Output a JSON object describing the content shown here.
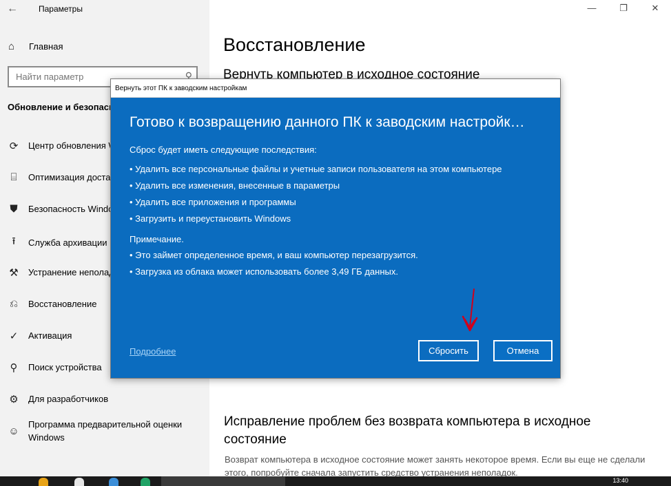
{
  "window": {
    "back_icon": "back-arrow-icon",
    "title": "Параметры",
    "controls": {
      "minimize": "—",
      "maximize": "❐",
      "close": "✕"
    }
  },
  "sidebar": {
    "home_label": "Главная",
    "search_placeholder": "Найти параметр",
    "section_title": "Обновление и безопасность",
    "items": [
      {
        "icon": "sync-icon",
        "glyph": "⟳",
        "label": "Центр обновления Windows"
      },
      {
        "icon": "delivery-optimization-icon",
        "glyph": "⌸",
        "label": "Оптимизация доставки"
      },
      {
        "icon": "shield-icon",
        "glyph": "⛊",
        "label": "Безопасность Windows"
      },
      {
        "icon": "backup-icon",
        "glyph": "⭱",
        "label": "Служба архивации"
      },
      {
        "icon": "wrench-icon",
        "glyph": "⚒",
        "label": "Устранение неполадок"
      },
      {
        "icon": "recovery-icon",
        "glyph": "⎌",
        "label": "Восстановление"
      },
      {
        "icon": "activation-icon",
        "glyph": "✓",
        "label": "Активация"
      },
      {
        "icon": "find-device-icon",
        "glyph": "⚲",
        "label": "Поиск устройства"
      },
      {
        "icon": "developer-icon",
        "glyph": "⚙",
        "label": "Для разработчиков"
      },
      {
        "icon": "insider-icon",
        "glyph": "☺",
        "label": "Программа предварительной оценки Windows"
      }
    ]
  },
  "main": {
    "heading": "Восстановление",
    "subheading": "Вернуть компьютер в исходное состояние",
    "fix_heading": "Исправление проблем без возврата компьютера в исходное состояние",
    "fix_description": "Возврат компьютера в исходное состояние может занять некоторое время. Если вы еще не сделали этого, попробуйте сначала запустить средство устранения неполадок."
  },
  "dialog": {
    "title": "Вернуть этот ПК к заводским настройкам",
    "heading": "Готово к возвращению данного ПК к заводским настройк…",
    "intro": "Сброс будет иметь следующие последствия:",
    "consequences": [
      "• Удалить все персональные файлы и учетные записи пользователя на этом компьютере",
      "• Удалить все изменения, внесенные в параметры",
      "• Удалить все приложения и программы",
      "• Загрузить и переустановить Windows"
    ],
    "note_title": "Примечание.",
    "notes": [
      "• Это займет определенное время, и ваш компьютер перезагрузится.",
      "• Загрузка из облака может использовать более 3,49 ГБ данных."
    ],
    "more_link": "Подробнее",
    "reset_button": "Сбросить",
    "cancel_button": "Отмена",
    "colors": {
      "background": "#0b6cbf",
      "annotation_arrow": "#d0001b"
    }
  },
  "taskbar": {
    "clock": "13:40"
  }
}
